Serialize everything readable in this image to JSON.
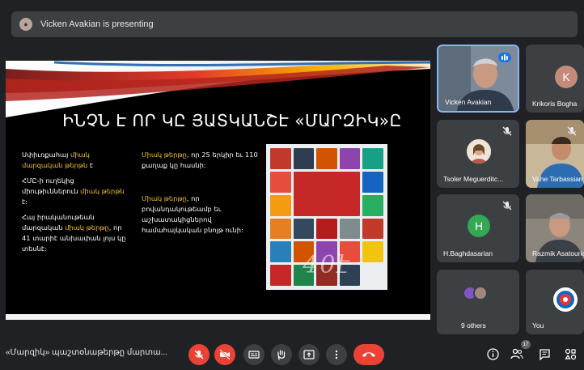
{
  "presenting_banner": {
    "text": "Vicken Avakian is presenting"
  },
  "slide": {
    "title": "ԻՆՉՆ Է ՈՐ ԿԸ ՅԱՏԿԱՆՇԷ «ՄԱՐԶԻԿ»Ը",
    "col1": [
      {
        "pre": "Սփիւռքահայ ",
        "hl": "միակ մարզական թերթն",
        "post": " է"
      },
      {
        "pre": "ՀՄԸ-ի ուղեկից միութիւններուն ",
        "hl": "միակ թերթն",
        "post": " է:"
      },
      {
        "pre": "Հայ իրականութեան մարզական ",
        "hl": "միակ թերթը",
        "post": ", որ 41 տարիէ անխափան լոյս կը տեսնէ:"
      }
    ],
    "col2": [
      {
        "pre": "",
        "hl": "Միակ թերթը",
        "post": ", որ 25 երկիր եւ 110 քաղաք կը հասնի:"
      },
      {
        "pre": "",
        "hl": "Միակ թերթը",
        "post": ", որ բովանդակութեամբ եւ աշխատակիցներով համահայկական բնոյթ ունի:"
      }
    ],
    "collage_overlay": "40է"
  },
  "participants": [
    {
      "name": "Vicken Avakian",
      "speaking": true
    },
    {
      "name": "Krikoris Bogha",
      "initial": "K",
      "avatar_color": "#c58b7a"
    },
    {
      "name": "Tsoler Meguerditc...",
      "muted": true
    },
    {
      "name": "Vahe Tarbassian",
      "muted": true
    },
    {
      "name": "H.Baghdasarian",
      "initial": "H",
      "avatar_color": "#34a853",
      "muted": true
    },
    {
      "name": "Razmik Asatourian"
    },
    {
      "name": "9 others"
    },
    {
      "name": "You"
    }
  ],
  "meeting": {
    "name": "«Մարզիկ» պաշտօնաթերթը մարտա...",
    "participants_count": "17"
  },
  "icons": {
    "mic": "mic-off-icon",
    "camera": "camera-off-icon",
    "captions": "captions-icon",
    "hand": "raise-hand-icon",
    "present": "present-icon",
    "more": "more-options-icon",
    "end": "end-call-icon",
    "info": "info-icon",
    "people": "people-icon",
    "chat": "chat-icon",
    "activities": "activities-icon"
  },
  "colors": {
    "accent": "#1a73e8",
    "danger": "#ea4335",
    "highlight": "#f2c12e"
  }
}
